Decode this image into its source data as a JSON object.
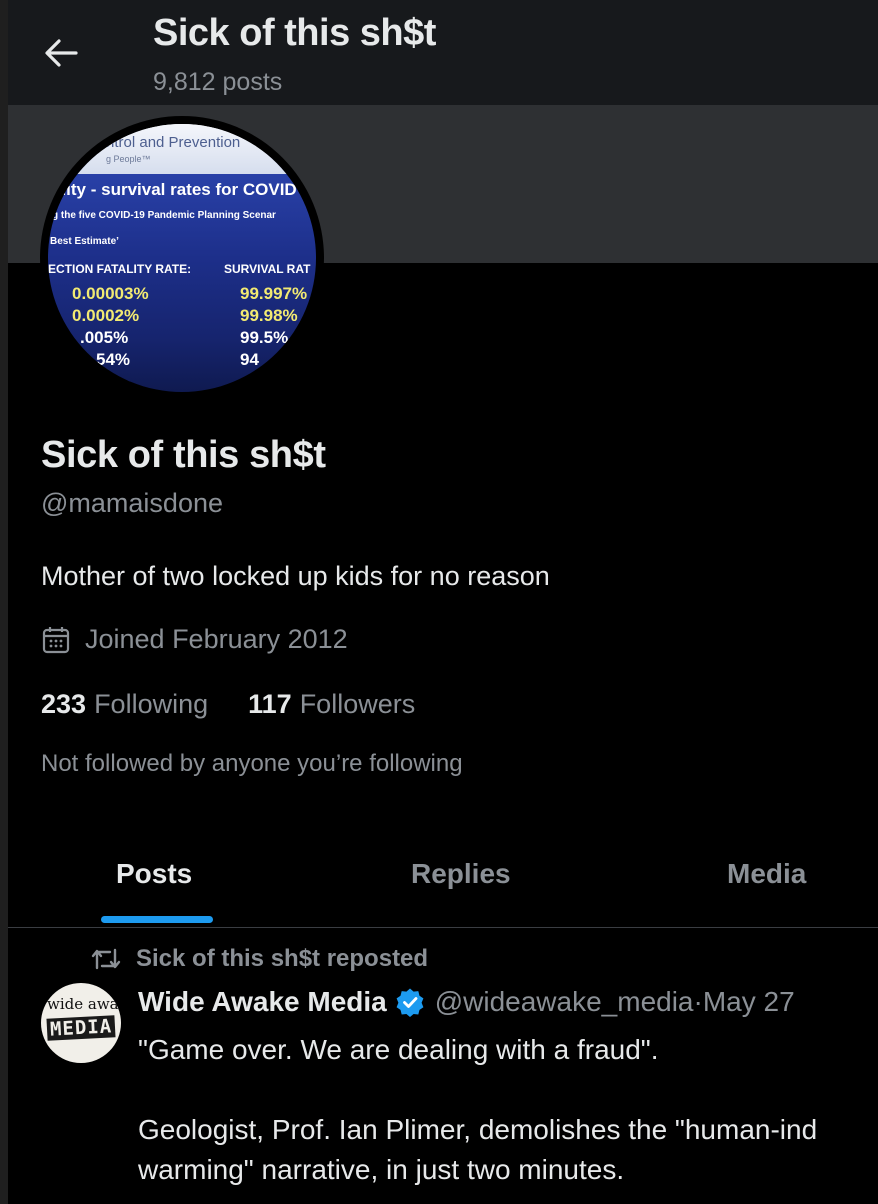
{
  "header": {
    "title": "Sick of this sh$t",
    "post_count": "9,812 posts"
  },
  "avatar_image_text": {
    "org": "ntrol and Prevention",
    "org2": "g People™",
    "heading": "ality - survival rates for COVID",
    "subheading": "g the five COVID-19 Pandemic Planning Scenar",
    "estimate": "Best Estimate’",
    "col1": "ECTION FATALITY RATE:",
    "col2": "SURVIVAL RAT",
    "fatality": [
      "0.00003%",
      "0.0002%",
      ".005%",
      "54%"
    ],
    "survival": [
      "99.997%",
      "99.98%",
      "99.5%",
      "94"
    ]
  },
  "profile": {
    "name": "Sick of this sh$t",
    "handle": "@mamaisdone",
    "bio": "Mother of two locked up kids for no reason",
    "joined": "Joined February 2012",
    "following_count": "233",
    "following_label": "Following",
    "followers_count": "117",
    "followers_label": "Followers",
    "not_followed": "Not followed by anyone you’re following"
  },
  "tabs": [
    {
      "label": "Posts",
      "active": true
    },
    {
      "label": "Replies",
      "active": false
    },
    {
      "label": "Media",
      "active": false
    }
  ],
  "post": {
    "repost_label": "Sick of this sh$t reposted",
    "author_avatar_text": [
      "wide awake",
      "MEDIA"
    ],
    "author": "Wide Awake Media",
    "verified": true,
    "author_handle": "@wideawake_media",
    "separator": " · ",
    "date": "May 27",
    "text": "\"Game over. We are dealing with a fraud\".\n\nGeologist, Prof. Ian Plimer, demolishes the \"human-ind\nwarming\" narrative, in just two minutes."
  },
  "colors": {
    "accent": "#1d9bf0",
    "muted": "#8b9096",
    "text": "#e7e9ea"
  },
  "icons": {
    "back": "arrow-left-icon",
    "calendar": "calendar-icon",
    "repost": "repost-icon",
    "verified": "verified-badge-icon"
  }
}
